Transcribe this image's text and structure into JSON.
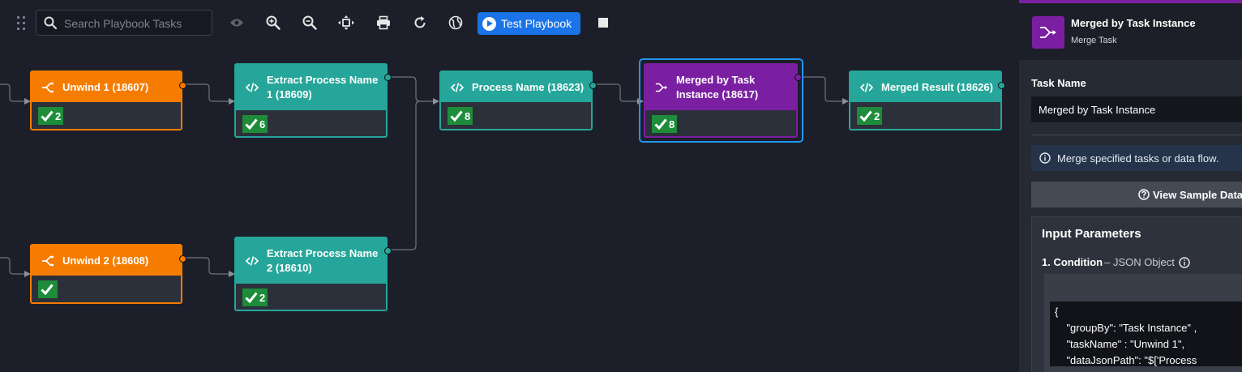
{
  "toolbar": {
    "search_placeholder": "Search Playbook Tasks",
    "test_playbook_label": "Test Playbook",
    "icons": [
      "drag-handle-icon",
      "eye-icon",
      "zoom-in-icon",
      "zoom-out-icon",
      "fit-view-icon",
      "print-icon",
      "refresh-icon",
      "globe-icon",
      "play-icon",
      "stop-icon"
    ]
  },
  "nodes": [
    {
      "id": "n1",
      "title": "Unwind 1 (18607)",
      "count": "2",
      "kind": "unwind"
    },
    {
      "id": "n2",
      "title": "Unwind 2 (18608)",
      "count": "",
      "kind": "unwind"
    },
    {
      "id": "n3",
      "title": "Extract Process Name 1 (18609)",
      "count": "6",
      "kind": "code"
    },
    {
      "id": "n4",
      "title": "Extract Process Name 2 (18610)",
      "count": "2",
      "kind": "code"
    },
    {
      "id": "n5",
      "title": "Process Name (18623)",
      "count": "8",
      "kind": "code"
    },
    {
      "id": "n6",
      "title": "Merged by Task Instance (18617)",
      "count": "8",
      "kind": "merge",
      "selected": true
    },
    {
      "id": "n7",
      "title": "Merged Result (18626)",
      "count": "2",
      "kind": "code"
    }
  ],
  "panel": {
    "title": "Merged by Task Instance",
    "subtitle": "Merge Task",
    "task_name_label": "Task Name",
    "task_name_value": "Merged by Task Instance",
    "info_text": "Merge specified tasks or data flow.",
    "sample_data_label": "View Sample Data",
    "input_params_title": "Input Parameters",
    "condition_name": "1. Condition",
    "condition_type": "– JSON Object",
    "condition_code": "{\n    \"groupBy\": \"Task Instance\" ,\n    \"taskName\" : \"Unwind 1\",\n    \"dataJsonPath\": \"$['Process"
  },
  "colors": {
    "unwind": "#f57c00",
    "code": "#26a69a",
    "merge": "#7b1fa2",
    "selected": "#2196f3",
    "success": "#1e8c3a",
    "accent_blue": "#1a73e8"
  }
}
